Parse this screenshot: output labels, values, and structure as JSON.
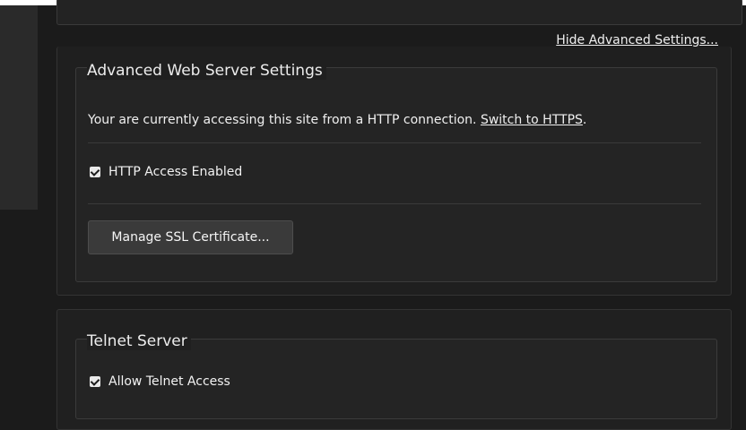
{
  "advanced": {
    "hide_link_label": "Hide Advanced Settings...",
    "section_title": "Advanced Web Server Settings",
    "info_prefix": "Your are currently accessing this site from a HTTP connection. ",
    "info_link": "Switch to HTTPS",
    "info_suffix": ".",
    "http_access": {
      "label": "HTTP Access Enabled",
      "checked": true
    },
    "ssl_button_label": "Manage SSL Certificate..."
  },
  "telnet": {
    "section_title": "Telnet Server",
    "allow_access": {
      "label": "Allow Telnet Access",
      "checked": true
    }
  }
}
